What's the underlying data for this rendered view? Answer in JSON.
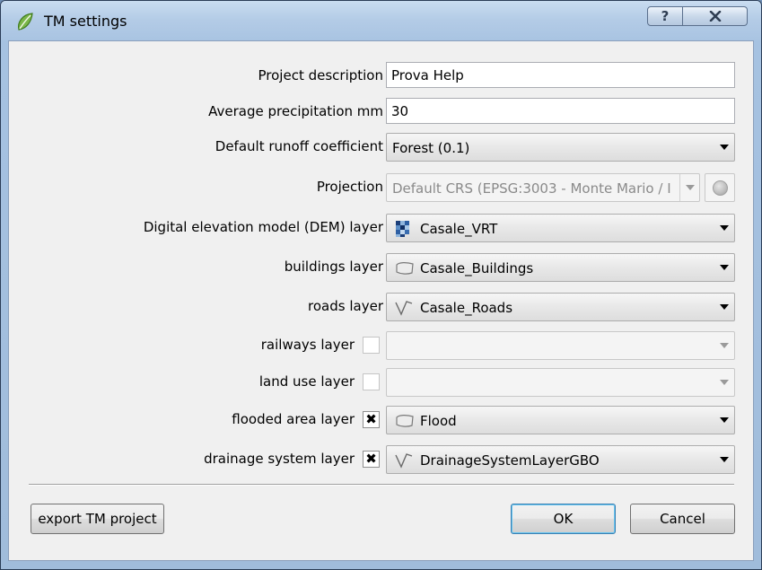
{
  "window": {
    "title": "TM settings",
    "help_label": "?",
    "close_label": "X",
    "icon": "qgis-leaf-icon"
  },
  "form": {
    "project_description": {
      "label": "Project description",
      "value": "Prova Help"
    },
    "avg_precipitation": {
      "label": "Average precipitation mm",
      "value": "30"
    },
    "runoff": {
      "label": "Default runoff coefficient",
      "value": "Forest (0.1)"
    },
    "projection": {
      "label": "Projection",
      "value": "Default CRS (EPSG:3003 - Monte Mario / I",
      "button_icon": "globe-icon"
    },
    "dem": {
      "label": "Digital elevation model (DEM) layer",
      "value": "Casale_VRT",
      "icon": "raster-layer-icon"
    },
    "buildings": {
      "label": "buildings layer",
      "value": "Casale_Buildings",
      "icon": "polygon-layer-icon"
    },
    "roads": {
      "label": "roads layer",
      "value": "Casale_Roads",
      "icon": "line-layer-icon"
    },
    "railways": {
      "label": "railways layer",
      "checked": false,
      "value": ""
    },
    "landuse": {
      "label": "land use layer",
      "checked": false,
      "value": ""
    },
    "flooded": {
      "label": "flooded area layer",
      "checked": true,
      "check_mark": "✖",
      "value": "Flood",
      "icon": "polygon-layer-icon"
    },
    "drainage": {
      "label": "drainage system layer",
      "checked": true,
      "check_mark": "✖",
      "value": "DrainageSystemLayerGBO",
      "icon": "line-layer-icon"
    }
  },
  "buttons": {
    "export": "export TM project",
    "ok": "OK",
    "cancel": "Cancel"
  }
}
